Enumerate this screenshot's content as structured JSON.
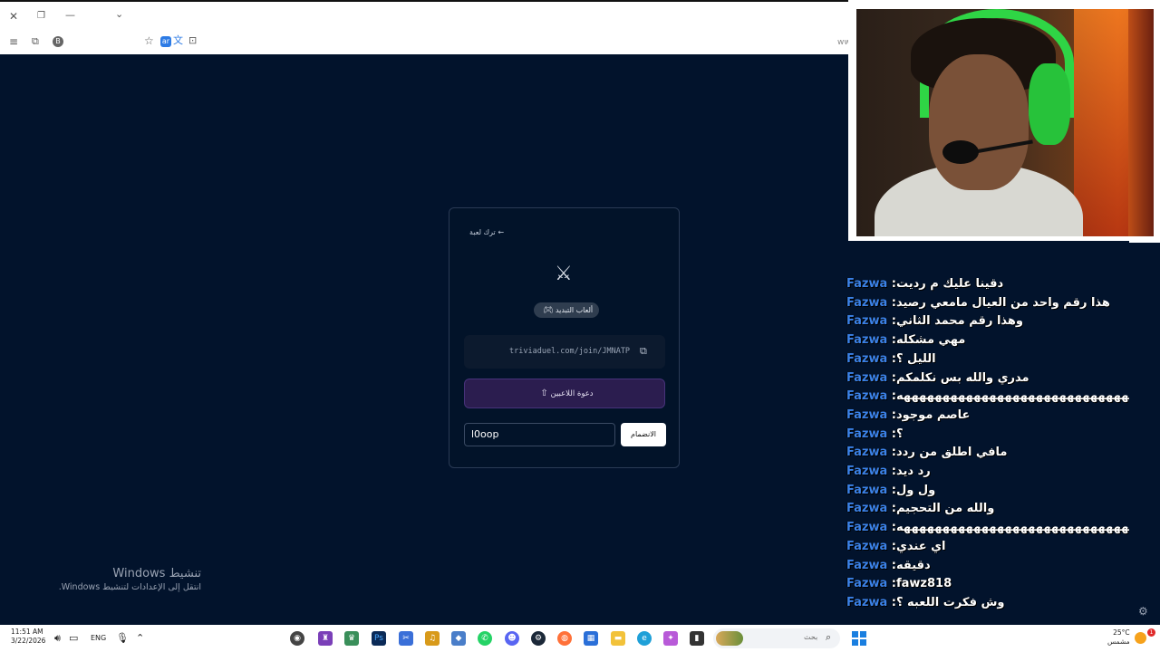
{
  "browser": {
    "close_icon": "close-icon",
    "restore_icon": "restore-icon",
    "minimize_icon": "minimize-icon",
    "tabs_dropdown_icon": "chevron-down-icon",
    "menu_icon": "menu-icon",
    "url_stub": "ww"
  },
  "card": {
    "back_link": "← ترك لعبة",
    "mode_label": "ألعاب التبديد",
    "join_link": "triviaduel.com/join/JMNATP",
    "invite_button": "دعوة اللاعبين",
    "name_input_value": "l0oop",
    "join_button": "الانضمام"
  },
  "windows_activation": {
    "title": "تنشيط Windows",
    "subtitle": "انتقل إلى الإعدادات لتنشيط Windows."
  },
  "chat": {
    "messages": [
      {
        "user": "Fazwa",
        "text": "دقينا عليك م رديت"
      },
      {
        "user": "Fazwa",
        "text": "هذا رقم واحد من العيال مامعي رصيد"
      },
      {
        "user": "Fazwa",
        "text": "وهذا رقم محمد الثاني"
      },
      {
        "user": "Fazwa",
        "text": "مهي مشكله"
      },
      {
        "user": "Fazwa",
        "text": "الليل ؟"
      },
      {
        "user": "Fazwa",
        "text": "مدري والله بس نكلمكم"
      },
      {
        "user": "Fazwa",
        "text": "ههههههههههههههههههههههههههههههههههههه"
      },
      {
        "user": "Fazwa",
        "text": "عاصم موجود"
      },
      {
        "user": "Fazwa",
        "text": "؟"
      },
      {
        "user": "Fazwa",
        "text": "مافي اطلق من ردد"
      },
      {
        "user": "Fazwa",
        "text": "رد ديد"
      },
      {
        "user": "Fazwa",
        "text": "ول ول"
      },
      {
        "user": "Fazwa",
        "text": "والله من التحجيم"
      },
      {
        "user": "Fazwa",
        "text": "ههههههههههههههههههههههههههههههههههههه"
      },
      {
        "user": "Fazwa",
        "text": "اي عندي"
      },
      {
        "user": "Fazwa",
        "text": "دقيقه"
      },
      {
        "user": "Fazwa",
        "text": "fawz818"
      },
      {
        "user": "Fazwa",
        "text": "وش فكرت اللعبه ؟"
      }
    ]
  },
  "taskbar": {
    "time": "11:51 AM",
    "date": "3/22/2026",
    "language": "ENG",
    "search_placeholder": "بحث",
    "temperature": "25°C",
    "weather_label": "مشمس",
    "notification_count": "1"
  },
  "colors": {
    "background": "#02132c",
    "chat_username": "#3b82e8",
    "invite_button": "#2b1d4f"
  }
}
